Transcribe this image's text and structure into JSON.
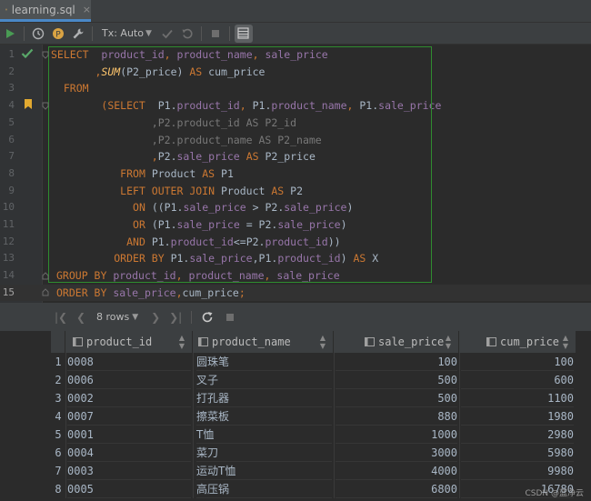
{
  "tab": {
    "label": "learning.sql",
    "close": "×"
  },
  "toolbar": {
    "tx_label": "Tx: Auto"
  },
  "editor": {
    "lines": [
      {
        "n": "1"
      },
      {
        "n": "2"
      },
      {
        "n": "3"
      },
      {
        "n": "4"
      },
      {
        "n": "5"
      },
      {
        "n": "6"
      },
      {
        "n": "7"
      },
      {
        "n": "8"
      },
      {
        "n": "9"
      },
      {
        "n": "10"
      },
      {
        "n": "11"
      },
      {
        "n": "12"
      },
      {
        "n": "13"
      },
      {
        "n": "14"
      },
      {
        "n": "15"
      }
    ],
    "code": {
      "l1": [
        "SELECT",
        "product_id",
        ",",
        "product_name",
        ",",
        "sale_price"
      ],
      "l2": [
        ",",
        "SUM",
        "(P2_price)",
        "AS",
        "cum_price"
      ],
      "l3": [
        "FROM"
      ],
      "l4": [
        "(SELECT",
        "P1.",
        "product_id",
        ",",
        "P1.",
        "product_name",
        ",",
        "P1.",
        "sale_price"
      ],
      "l5": [
        ",P2.product_id AS P2_id"
      ],
      "l6": [
        ",P2.product_name AS P2_name"
      ],
      "l7": [
        ",",
        "P2.",
        "sale_price",
        "AS",
        "P2_price"
      ],
      "l8": [
        "FROM",
        "Product",
        "AS",
        "P1"
      ],
      "l9": [
        "LEFT OUTER JOIN",
        "Product",
        "AS",
        "P2"
      ],
      "l10": [
        "ON",
        "((P1.",
        "sale_price",
        "> P2.",
        "sale_price",
        ")"
      ],
      "l11": [
        "OR",
        "(P1.",
        "sale_price",
        "= P2.",
        "sale_price",
        ")"
      ],
      "l12": [
        "AND",
        "P1.",
        "product_id",
        "<=P2.",
        "product_id",
        "))"
      ],
      "l13": [
        "ORDER BY",
        "P1.",
        "sale_price",
        ",P1.",
        "product_id",
        ")",
        "AS",
        "X"
      ],
      "l14": [
        "GROUP BY",
        "product_id",
        ",",
        "product_name",
        ",",
        "sale_price"
      ],
      "l15": [
        "ORDER BY",
        "sale_price",
        ",",
        "cum_price",
        ";"
      ]
    }
  },
  "results": {
    "rows_label": "8 rows",
    "columns": [
      "product_id",
      "product_name",
      "sale_price",
      "cum_price"
    ],
    "rows": [
      {
        "n": "1",
        "product_id": "0008",
        "product_name": "圆珠笔",
        "sale_price": "100",
        "cum_price": "100"
      },
      {
        "n": "2",
        "product_id": "0006",
        "product_name": "叉子",
        "sale_price": "500",
        "cum_price": "600"
      },
      {
        "n": "3",
        "product_id": "0002",
        "product_name": "打孔器",
        "sale_price": "500",
        "cum_price": "1100"
      },
      {
        "n": "4",
        "product_id": "0007",
        "product_name": "擦菜板",
        "sale_price": "880",
        "cum_price": "1980"
      },
      {
        "n": "5",
        "product_id": "0001",
        "product_name": "T恤",
        "sale_price": "1000",
        "cum_price": "2980"
      },
      {
        "n": "6",
        "product_id": "0004",
        "product_name": "菜刀",
        "sale_price": "3000",
        "cum_price": "5980"
      },
      {
        "n": "7",
        "product_id": "0003",
        "product_name": "运动T恤",
        "sale_price": "4000",
        "cum_price": "9980"
      },
      {
        "n": "8",
        "product_id": "0005",
        "product_name": "高压锅",
        "sale_price": "6800",
        "cum_price": "16780"
      }
    ]
  },
  "watermark": "CSDN @蓝净云",
  "colors": {
    "keyword": "#cc7832",
    "field": "#9876aa",
    "function": "#ffc66d",
    "text": "#a9b7c6",
    "selection_border": "#2f8c2f"
  }
}
